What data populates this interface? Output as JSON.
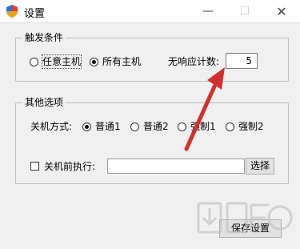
{
  "window": {
    "title": "设置",
    "minimize_glyph": "—",
    "maximize_glyph": "☐",
    "close_glyph": "✕"
  },
  "trigger_group": {
    "title": "触发条件",
    "options": [
      {
        "label": "任意主机",
        "selected": false
      },
      {
        "label": "所有主机",
        "selected": true
      }
    ],
    "no_response_label": "无响应计数:",
    "no_response_value": "5"
  },
  "other_group": {
    "title": "其他选项",
    "shutdown_mode_label": "关机方式:",
    "shutdown_modes": [
      {
        "label": "普通1",
        "selected": true
      },
      {
        "label": "普通2",
        "selected": false
      },
      {
        "label": "强制1",
        "selected": false
      },
      {
        "label": "强制2",
        "selected": false
      }
    ],
    "pre_shutdown_label": "关机前执行:",
    "pre_shutdown_checked": false,
    "pre_shutdown_value": "",
    "browse_label": "选择"
  },
  "footer": {
    "save_label": "保存设置"
  },
  "colors": {
    "annotation_arrow": "#d32f2f",
    "titlebar": "#ffffff",
    "window_bg": "#f0f0f0"
  },
  "icons": {
    "app": "shield-icon",
    "watermark": "download-site-watermark"
  }
}
